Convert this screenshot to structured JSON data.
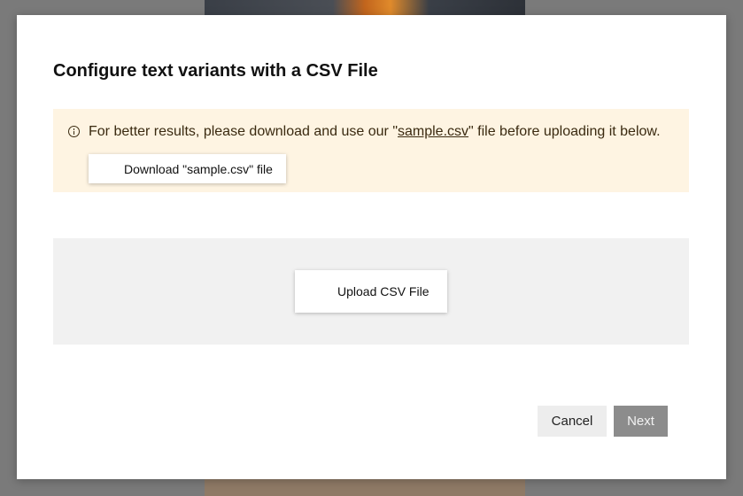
{
  "modal": {
    "title": "Configure text variants with a CSV File",
    "notice": {
      "icon": "info-icon",
      "text_before": "For better results, please download and use our \"",
      "link_text": "sample.csv",
      "text_after": "\" file before uploading it below.",
      "download_label": "Download \"sample.csv\" file"
    },
    "upload": {
      "label": "Upload CSV File"
    },
    "footer": {
      "cancel_label": "Cancel",
      "next_label": "Next"
    }
  },
  "colors": {
    "notice_bg": "#fef4e2",
    "upload_bg": "#f1f1f1",
    "next_disabled": "#8c8c8c"
  }
}
